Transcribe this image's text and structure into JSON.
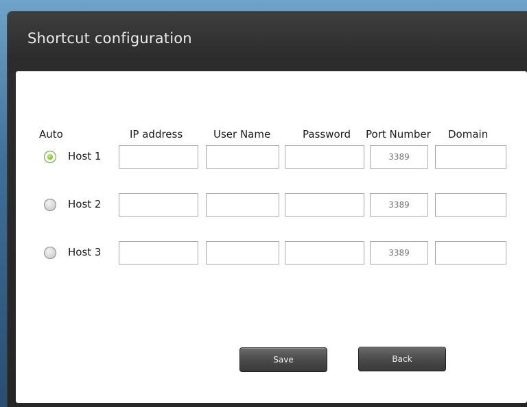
{
  "window": {
    "title": "Shortcut configuration"
  },
  "headers": {
    "auto": "Auto",
    "ip": "IP address",
    "user": "User Name",
    "password": "Password",
    "port": "Port Number",
    "domain": "Domain"
  },
  "hosts": [
    {
      "label": "Host 1",
      "selected": true,
      "ip": "",
      "user": "",
      "password": "",
      "port_placeholder": "3389",
      "domain": ""
    },
    {
      "label": "Host 2",
      "selected": false,
      "ip": "",
      "user": "",
      "password": "",
      "port_placeholder": "3389",
      "domain": ""
    },
    {
      "label": "Host 3",
      "selected": false,
      "ip": "",
      "user": "",
      "password": "",
      "port_placeholder": "3389",
      "domain": ""
    }
  ],
  "buttons": {
    "save": "Save",
    "back": "Back"
  },
  "colors": {
    "radio_selected": "#89c43a",
    "port_placeholder": "#c6c6c6"
  }
}
